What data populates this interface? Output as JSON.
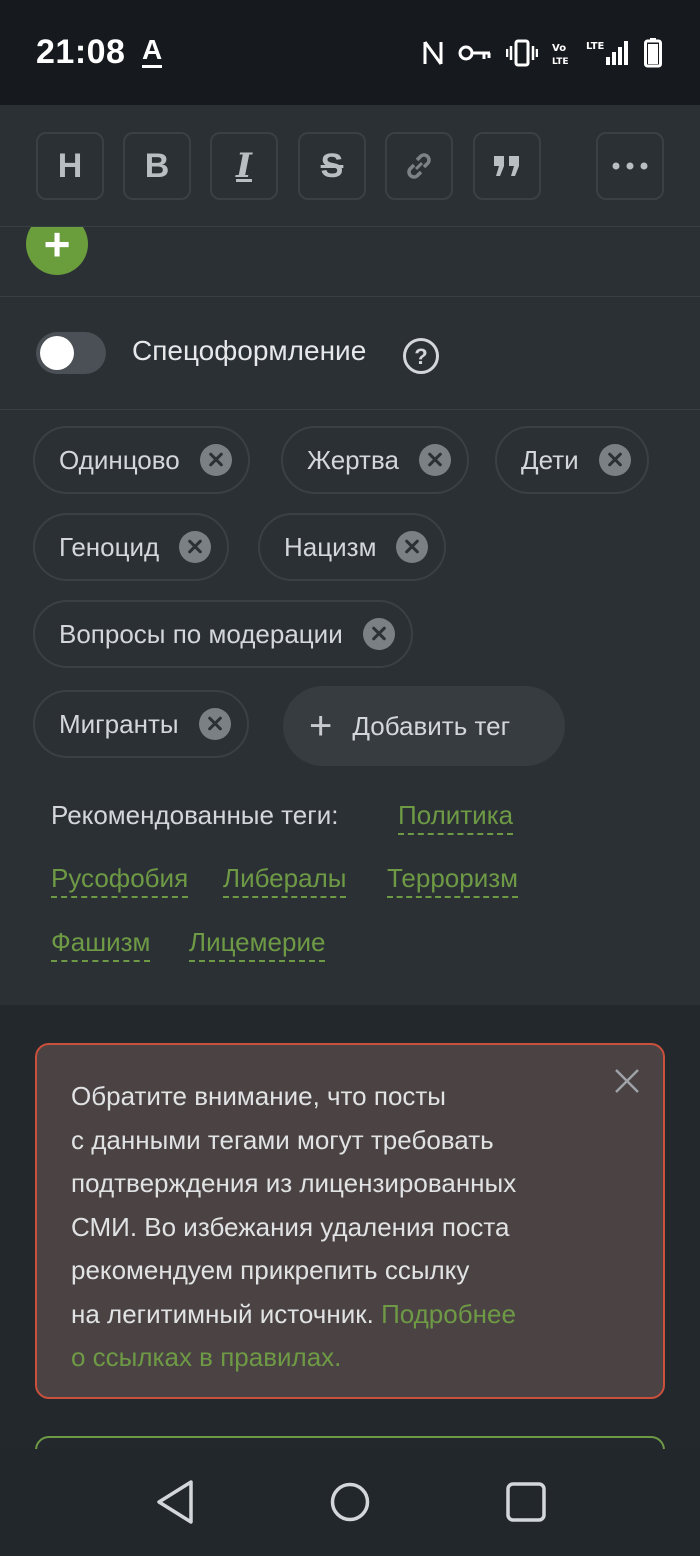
{
  "status_bar": {
    "time": "21:08",
    "keyboard_indicator": "A",
    "icons": [
      "nfc-icon",
      "vpn-key-icon",
      "vibrate-icon",
      "volte-icon",
      "lte-signal-icon",
      "battery-icon"
    ]
  },
  "toolbar": {
    "buttons": [
      {
        "name": "heading",
        "label": "H"
      },
      {
        "name": "bold",
        "label": "B"
      },
      {
        "name": "italic",
        "label": "I"
      },
      {
        "name": "strikethrough",
        "label": "S"
      },
      {
        "name": "link",
        "label": ""
      },
      {
        "name": "quote",
        "label": ""
      },
      {
        "name": "more",
        "label": ""
      }
    ]
  },
  "special_formatting": {
    "label": "Спецоформление",
    "enabled": false
  },
  "tags": [
    "Одинцово",
    "Жертва",
    "Дети",
    "Геноцид",
    "Нацизм",
    "Вопросы по модерации",
    "Мигранты"
  ],
  "add_tag_label": "Добавить тег",
  "recommended": {
    "label": "Рекомендованные теги:",
    "tags": [
      "Политика",
      "Русофобия",
      "Либералы",
      "Терроризм",
      "Фашизм",
      "Лицемерие"
    ]
  },
  "notice": {
    "line1": "Обратите внимание, что посты",
    "line2": "с данными тегами могут требовать",
    "line3": "подтверждения из лицензированных",
    "line4": "СМИ. Во избежания удаления поста",
    "line5": "рекомендуем прикрепить ссылку",
    "line6": "на легитимный источник. ",
    "link1": "Подробнее",
    "link2": "о ссылках в правилах."
  },
  "colors": {
    "accent_green": "#6e9a45",
    "warning_border": "#c8503c",
    "panel": "#2b3035"
  }
}
